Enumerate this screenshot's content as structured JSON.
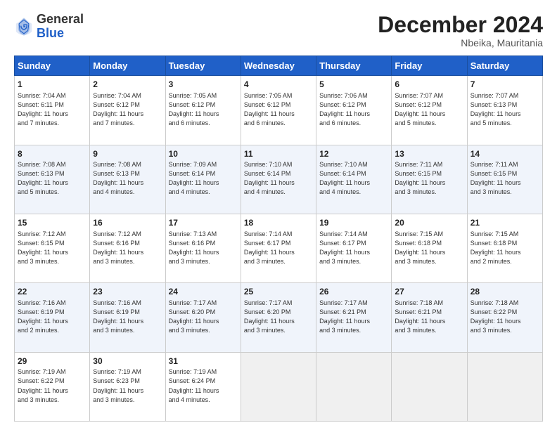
{
  "header": {
    "logo_general": "General",
    "logo_blue": "Blue",
    "month_title": "December 2024",
    "subtitle": "Nbeika, Mauritania"
  },
  "calendar": {
    "days_of_week": [
      "Sunday",
      "Monday",
      "Tuesday",
      "Wednesday",
      "Thursday",
      "Friday",
      "Saturday"
    ],
    "rows": [
      [
        {
          "day": "1",
          "info": "Sunrise: 7:04 AM\nSunset: 6:11 PM\nDaylight: 11 hours\nand 7 minutes."
        },
        {
          "day": "2",
          "info": "Sunrise: 7:04 AM\nSunset: 6:12 PM\nDaylight: 11 hours\nand 7 minutes."
        },
        {
          "day": "3",
          "info": "Sunrise: 7:05 AM\nSunset: 6:12 PM\nDaylight: 11 hours\nand 6 minutes."
        },
        {
          "day": "4",
          "info": "Sunrise: 7:05 AM\nSunset: 6:12 PM\nDaylight: 11 hours\nand 6 minutes."
        },
        {
          "day": "5",
          "info": "Sunrise: 7:06 AM\nSunset: 6:12 PM\nDaylight: 11 hours\nand 6 minutes."
        },
        {
          "day": "6",
          "info": "Sunrise: 7:07 AM\nSunset: 6:12 PM\nDaylight: 11 hours\nand 5 minutes."
        },
        {
          "day": "7",
          "info": "Sunrise: 7:07 AM\nSunset: 6:13 PM\nDaylight: 11 hours\nand 5 minutes."
        }
      ],
      [
        {
          "day": "8",
          "info": "Sunrise: 7:08 AM\nSunset: 6:13 PM\nDaylight: 11 hours\nand 5 minutes."
        },
        {
          "day": "9",
          "info": "Sunrise: 7:08 AM\nSunset: 6:13 PM\nDaylight: 11 hours\nand 4 minutes."
        },
        {
          "day": "10",
          "info": "Sunrise: 7:09 AM\nSunset: 6:14 PM\nDaylight: 11 hours\nand 4 minutes."
        },
        {
          "day": "11",
          "info": "Sunrise: 7:10 AM\nSunset: 6:14 PM\nDaylight: 11 hours\nand 4 minutes."
        },
        {
          "day": "12",
          "info": "Sunrise: 7:10 AM\nSunset: 6:14 PM\nDaylight: 11 hours\nand 4 minutes."
        },
        {
          "day": "13",
          "info": "Sunrise: 7:11 AM\nSunset: 6:15 PM\nDaylight: 11 hours\nand 3 minutes."
        },
        {
          "day": "14",
          "info": "Sunrise: 7:11 AM\nSunset: 6:15 PM\nDaylight: 11 hours\nand 3 minutes."
        }
      ],
      [
        {
          "day": "15",
          "info": "Sunrise: 7:12 AM\nSunset: 6:15 PM\nDaylight: 11 hours\nand 3 minutes."
        },
        {
          "day": "16",
          "info": "Sunrise: 7:12 AM\nSunset: 6:16 PM\nDaylight: 11 hours\nand 3 minutes."
        },
        {
          "day": "17",
          "info": "Sunrise: 7:13 AM\nSunset: 6:16 PM\nDaylight: 11 hours\nand 3 minutes."
        },
        {
          "day": "18",
          "info": "Sunrise: 7:14 AM\nSunset: 6:17 PM\nDaylight: 11 hours\nand 3 minutes."
        },
        {
          "day": "19",
          "info": "Sunrise: 7:14 AM\nSunset: 6:17 PM\nDaylight: 11 hours\nand 3 minutes."
        },
        {
          "day": "20",
          "info": "Sunrise: 7:15 AM\nSunset: 6:18 PM\nDaylight: 11 hours\nand 3 minutes."
        },
        {
          "day": "21",
          "info": "Sunrise: 7:15 AM\nSunset: 6:18 PM\nDaylight: 11 hours\nand 2 minutes."
        }
      ],
      [
        {
          "day": "22",
          "info": "Sunrise: 7:16 AM\nSunset: 6:19 PM\nDaylight: 11 hours\nand 2 minutes."
        },
        {
          "day": "23",
          "info": "Sunrise: 7:16 AM\nSunset: 6:19 PM\nDaylight: 11 hours\nand 3 minutes."
        },
        {
          "day": "24",
          "info": "Sunrise: 7:17 AM\nSunset: 6:20 PM\nDaylight: 11 hours\nand 3 minutes."
        },
        {
          "day": "25",
          "info": "Sunrise: 7:17 AM\nSunset: 6:20 PM\nDaylight: 11 hours\nand 3 minutes."
        },
        {
          "day": "26",
          "info": "Sunrise: 7:17 AM\nSunset: 6:21 PM\nDaylight: 11 hours\nand 3 minutes."
        },
        {
          "day": "27",
          "info": "Sunrise: 7:18 AM\nSunset: 6:21 PM\nDaylight: 11 hours\nand 3 minutes."
        },
        {
          "day": "28",
          "info": "Sunrise: 7:18 AM\nSunset: 6:22 PM\nDaylight: 11 hours\nand 3 minutes."
        }
      ],
      [
        {
          "day": "29",
          "info": "Sunrise: 7:19 AM\nSunset: 6:22 PM\nDaylight: 11 hours\nand 3 minutes."
        },
        {
          "day": "30",
          "info": "Sunrise: 7:19 AM\nSunset: 6:23 PM\nDaylight: 11 hours\nand 3 minutes."
        },
        {
          "day": "31",
          "info": "Sunrise: 7:19 AM\nSunset: 6:24 PM\nDaylight: 11 hours\nand 4 minutes."
        },
        null,
        null,
        null,
        null
      ]
    ]
  }
}
